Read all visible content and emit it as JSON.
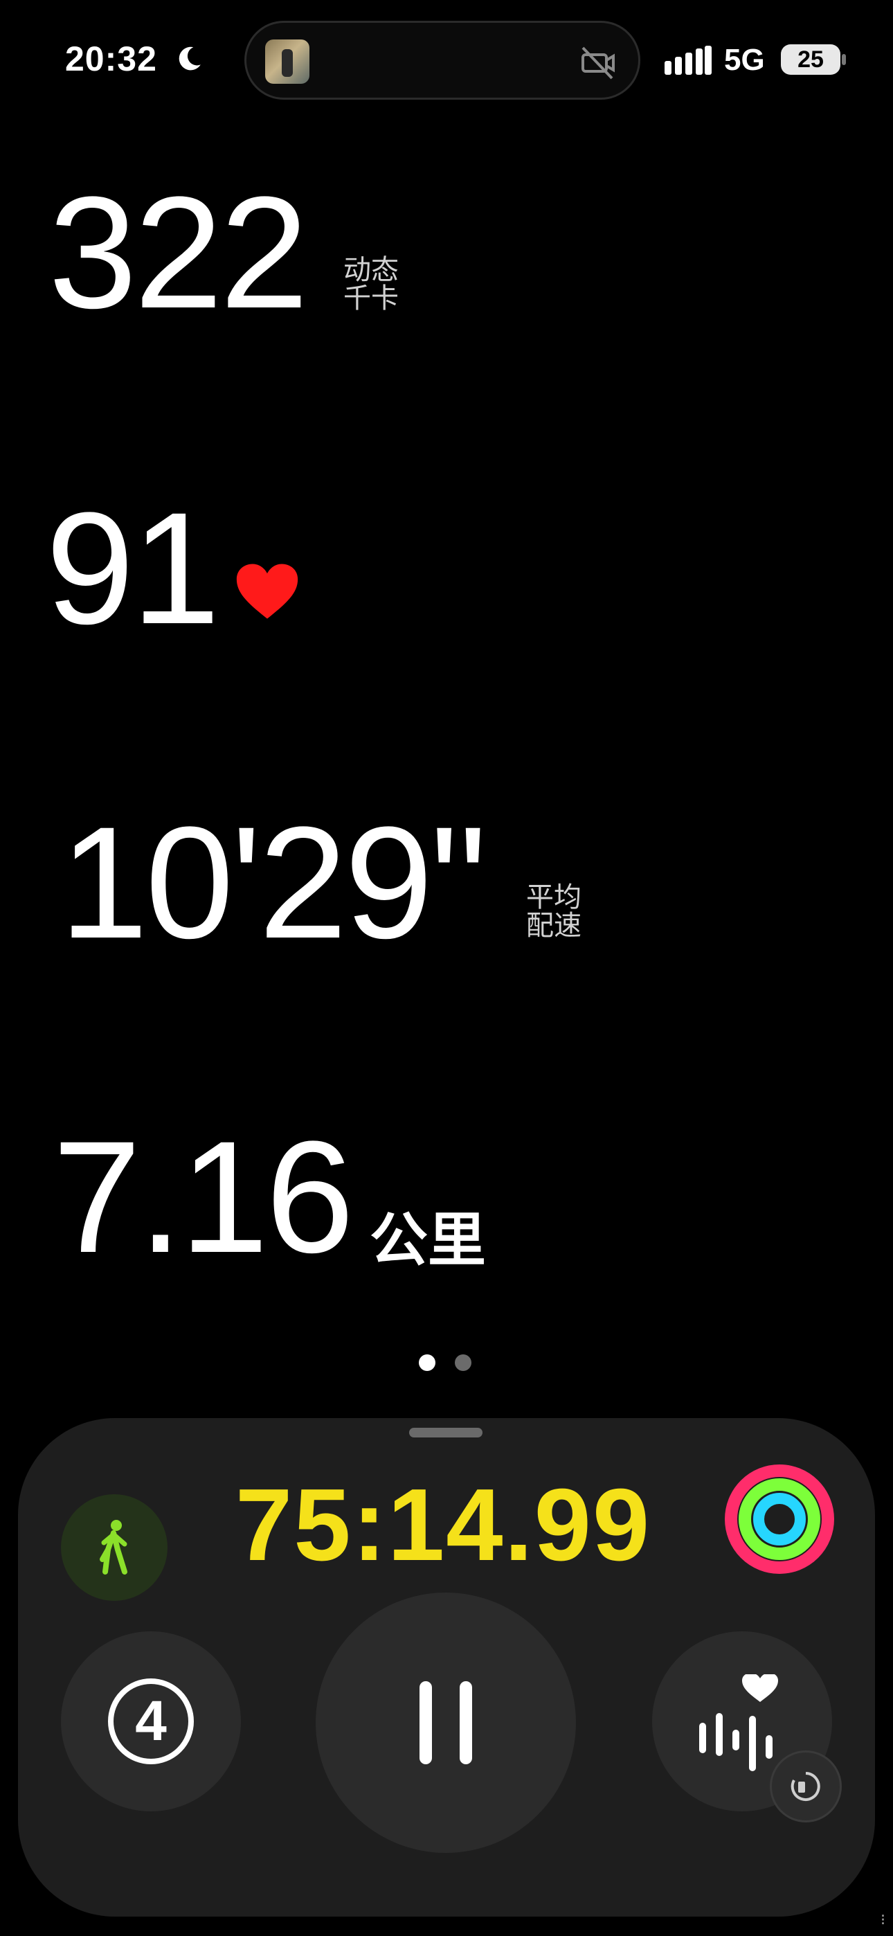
{
  "status_bar": {
    "time": "20:32",
    "network": "5G",
    "battery": "25"
  },
  "metrics": {
    "calories": {
      "value": "322",
      "unit_line1": "动态",
      "unit_line2": "千卡"
    },
    "heart_rate": {
      "value": "91"
    },
    "pace": {
      "value": "10'29\"",
      "unit_line1": "平均",
      "unit_line2": "配速"
    },
    "distance": {
      "value": "7.16",
      "unit": "公里"
    }
  },
  "pager": {
    "total": 2,
    "current": 1
  },
  "controls": {
    "elapsed": "75:14.99",
    "lap_count": "4"
  },
  "colors": {
    "timer": "#f5e11a",
    "heart": "#ff1a1a",
    "walk_icon": "#8be02a",
    "ring_move": "#ff2d6b",
    "ring_exercise": "#7dff3a",
    "ring_stand": "#26d6ff"
  },
  "icons": [
    "moon-icon",
    "camera-off-icon",
    "signal-icon",
    "heart-icon",
    "walk-icon",
    "activity-rings-icon",
    "lap-icon",
    "pause-icon",
    "heart-rate-icon",
    "workout-view-icon"
  ]
}
